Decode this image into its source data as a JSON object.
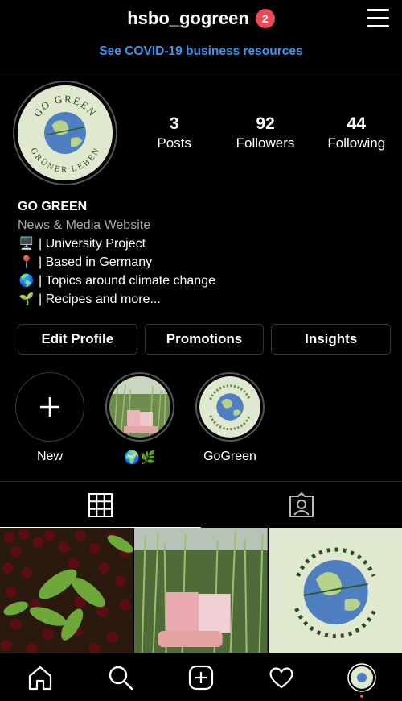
{
  "header": {
    "username": "hsbo_gogreen",
    "notification_count": "2",
    "menu_icon": "hamburger-menu-icon"
  },
  "banner": {
    "covid_link": "See COVID-19 business resources"
  },
  "profile": {
    "stats": [
      {
        "number": "3",
        "label": "Posts"
      },
      {
        "number": "92",
        "label": "Followers"
      },
      {
        "number": "44",
        "label": "Following"
      }
    ],
    "name": "GO GREEN",
    "category": "News & Media Website",
    "bio": [
      {
        "emoji": "🖥️",
        "text": "| University Project"
      },
      {
        "emoji": "📍",
        "text": "| Based in Germany"
      },
      {
        "emoji": "🌎",
        "text": "| Topics around climate change"
      },
      {
        "emoji": "🌱",
        "text": "| Recipes and more..."
      }
    ],
    "logo": {
      "top_text": "GO GREEN",
      "bottom_text": "GRÜNER LEBEN"
    }
  },
  "actions": {
    "edit_profile": "Edit Profile",
    "promotions": "Promotions",
    "insights": "Insights"
  },
  "highlights": [
    {
      "label": "New"
    },
    {
      "label": "🌍🌿"
    },
    {
      "label": "GoGreen"
    }
  ],
  "tabs": [
    {
      "name": "grid-icon",
      "active": true
    },
    {
      "name": "tagged-icon",
      "active": false
    }
  ],
  "posts": [
    {
      "subject": "cherries"
    },
    {
      "subject": "chives-foamie"
    },
    {
      "subject": "gogreen-logo"
    }
  ],
  "colors": {
    "accent": "#3797f0",
    "badge": "#ed4956",
    "bg": "#000000",
    "logo_bg": "#dfe9cf",
    "globe_blue": "#4f7fc0",
    "globe_green": "#b7d28a"
  }
}
